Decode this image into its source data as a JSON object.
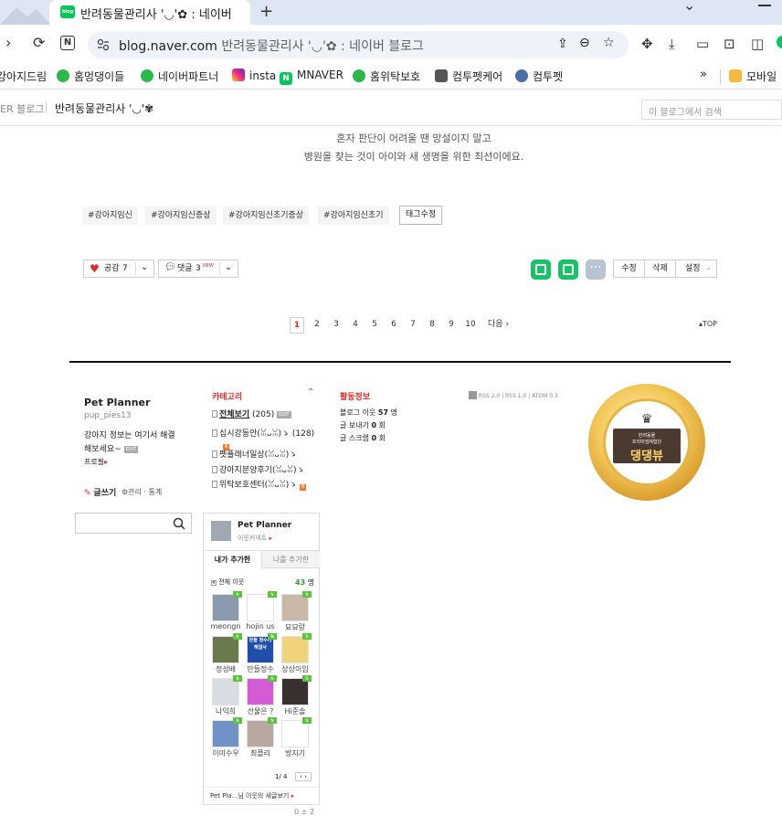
{
  "browser": {
    "tab_title": "반려동물관리사 '◡'✿ : 네이버",
    "url_domain": "blog.naver.com",
    "url_rest": "반려동물관리사 '◡'✿ : 네이버 블로그",
    "tab_fav_text": "blog"
  },
  "bookmarks": [
    {
      "label": "강아지드림",
      "color": "#ffffff"
    },
    {
      "label": "홈멍댕이들",
      "color": "#2db84b"
    },
    {
      "label": "네이버파트너",
      "color": "#2db84b"
    },
    {
      "label": "insta",
      "color": "#d6249f"
    },
    {
      "label": "MNAVER",
      "color": "#03c75a"
    },
    {
      "label": "홈위탁보호",
      "color": "#2db84b"
    },
    {
      "label": "컴투펫케어",
      "color": "#555555"
    },
    {
      "label": "컴투펫",
      "color": "#4a6fa5"
    }
  ],
  "bookmarks_more": "»",
  "bookmarks_folder": "모바일",
  "blog": {
    "brand": "ER 블로그",
    "name": "반려동물관리사 '◡'✾",
    "search_placeholder": "이 블로그에서 검색"
  },
  "post": {
    "line1": "혼자 판단이 어려울 땐 망설이지 말고",
    "line2": "병원을 찾는 것이 아이와 새 생명을 위한 최선이에요."
  },
  "tags": [
    "#강아지임신",
    "#강아지임신증상",
    "#강아지임신초기증상",
    "#강아지임신초기"
  ],
  "tag_edit": "태그수정",
  "actions": {
    "like_label": "공감",
    "like_count": "7",
    "comment_label": "댓글",
    "comment_count": "3",
    "comment_new": "NEW",
    "edit": "수정",
    "delete": "삭제",
    "settings": "설정"
  },
  "pagination": {
    "pages": [
      "1",
      "2",
      "3",
      "4",
      "5",
      "6",
      "7",
      "8",
      "9",
      "10"
    ],
    "current": "1",
    "next": "다음",
    "top": "TOP"
  },
  "profile": {
    "name": "Pet Planner",
    "id": "pup_pies13",
    "intro1": "강아지 정보는 여기서 해결",
    "intro2": "해보세요~",
    "intro_badge": "EDIT",
    "profile_link": "프로필",
    "write": "글쓰기",
    "manage": "관리 · 통계"
  },
  "category": {
    "title": "카테고리",
    "all_label": "전체보기",
    "all_count": "(205)",
    "all_badge": "EDIT",
    "items": [
      {
        "label": "십시강동안(ꈍᴗꈍ)ゝ",
        "count": "(128)"
      },
      {
        "label": "펫플래너일상(ꈍᴗꈍ)ゝ",
        "count": ""
      },
      {
        "label": "강아지분양후기(ꈍᴗꈍ)ゝ",
        "count": ""
      },
      {
        "label": "위탁보호센터(ꈍᴗꈍ)ゝ",
        "count": ""
      }
    ]
  },
  "activity": {
    "title": "활동정보",
    "neighbors_label": "블로그 이웃",
    "neighbors_value": "57",
    "neighbors_unit": "명",
    "send_label": "글 보내기",
    "send_value": "0",
    "send_unit": "회",
    "scrap_label": "글 스크랩",
    "scrap_value": "0",
    "scrap_unit": "회"
  },
  "rss": {
    "rss2": "RSS 2.0",
    "rss1": "RSS 1.0",
    "atom": "ATOM 0.3"
  },
  "emblem": {
    "line1": "반려동물",
    "line2": "프리미엄체험단",
    "main": "댕댕뷰"
  },
  "neighbors_box": {
    "name": "Pet Planner",
    "sub": "이웃커넥트",
    "tab_added": "내가 추가한",
    "tab_added_me": "나를 추가한",
    "all_label": "전체 이웃",
    "count": "43",
    "count_unit": "명",
    "people": [
      {
        "name": "meongn",
        "color": "#8a9bb0"
      },
      {
        "name": "hojin us",
        "color": "#ffffff"
      },
      {
        "name": "묘묘랑",
        "color": "#c9b8a8"
      },
      {
        "name": "정성배",
        "color": "#6b7a4d"
      },
      {
        "name": "만들정수",
        "color": "#1f4fa8"
      },
      {
        "name": "상상이임",
        "color": "#f0d37a"
      },
      {
        "name": "나익희",
        "color": "#d8dde4"
      },
      {
        "name": "선물은 ?",
        "color": "#d35bd6"
      },
      {
        "name": "Hi준솔",
        "color": "#3a3030"
      },
      {
        "name": "이미수우",
        "color": "#6f92c6"
      },
      {
        "name": "최플리",
        "color": "#b9a8a0"
      },
      {
        "name": "방지기",
        "color": "#ffffff"
      }
    ],
    "thumb_texts": {
      "t4": "만들 정수리 해결사"
    },
    "pager": "1/ 4",
    "footer": "Pet Pla...님 이웃의 새글보기"
  },
  "bottom_hint": "0 ± 2"
}
